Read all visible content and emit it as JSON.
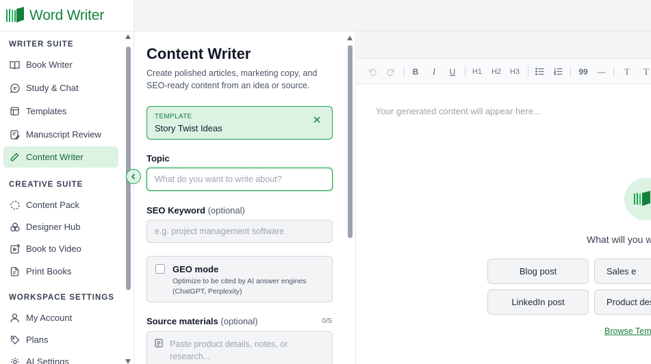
{
  "app": {
    "name": "Word Writer"
  },
  "sidebar": {
    "sections": [
      {
        "title": "WRITER SUITE"
      },
      {
        "title": "CREATIVE SUITE"
      },
      {
        "title": "WORKSPACE SETTINGS"
      }
    ],
    "items": [
      {
        "label": "Book Writer",
        "icon": "book-icon"
      },
      {
        "label": "Study & Chat",
        "icon": "chat-icon"
      },
      {
        "label": "Templates",
        "icon": "template-icon"
      },
      {
        "label": "Manuscript Review",
        "icon": "review-icon"
      },
      {
        "label": "Content Writer",
        "icon": "pencil-icon",
        "active": true
      },
      {
        "label": "Content Pack",
        "icon": "dotted-circle-icon"
      },
      {
        "label": "Designer Hub",
        "icon": "palette-icon"
      },
      {
        "label": "Book to Video",
        "icon": "video-icon"
      },
      {
        "label": "Print Books",
        "icon": "print-icon"
      },
      {
        "label": "My Account",
        "icon": "user-icon"
      },
      {
        "label": "Plans",
        "icon": "tag-icon"
      },
      {
        "label": "AI Settings",
        "icon": "gear-icon"
      }
    ]
  },
  "form": {
    "title": "Content Writer",
    "subtitle": "Create polished articles, marketing copy, and SEO-ready content from an idea or source.",
    "template": {
      "kicker": "TEMPLATE",
      "name": "Story Twist Ideas"
    },
    "topic": {
      "label": "Topic",
      "placeholder": "What do you want to write about?"
    },
    "seo": {
      "label": "SEO Keyword",
      "optional": "(optional)",
      "placeholder": "e.g. project management software"
    },
    "geo": {
      "title": "GEO mode",
      "description": "Optimize to be cited by AI answer engines (ChatGPT, Perplexity)",
      "checked": false
    },
    "source": {
      "label": "Source materials",
      "optional": "(optional)",
      "count": "0/5",
      "placeholder": "Paste product details, notes, or research..."
    }
  },
  "editor": {
    "toolbar": [
      "undo",
      "redo",
      "bold",
      "italic",
      "underline",
      "heading-1",
      "heading-2",
      "heading-3",
      "bullet-list",
      "numbered-list",
      "quote",
      "horizontal-rule",
      "text-size",
      "clear-format"
    ],
    "toolbar_labels": {
      "bold": "B",
      "italic": "I",
      "underline": "U",
      "h1": "H1",
      "h2": "H2",
      "h3": "H3",
      "quote": "99",
      "rule": "—",
      "text_size": "T",
      "clear_format": "T"
    },
    "placeholder": "Your generated content will appear here...",
    "prompt": "What will you w",
    "chips": [
      "Blog post",
      "Sales e",
      "LinkedIn post",
      "Product des"
    ],
    "browse_link": "Browse Tem"
  },
  "colors": {
    "accent": "#16a34a",
    "accent_light": "#dcf2e3",
    "accent_text": "#15803d"
  }
}
